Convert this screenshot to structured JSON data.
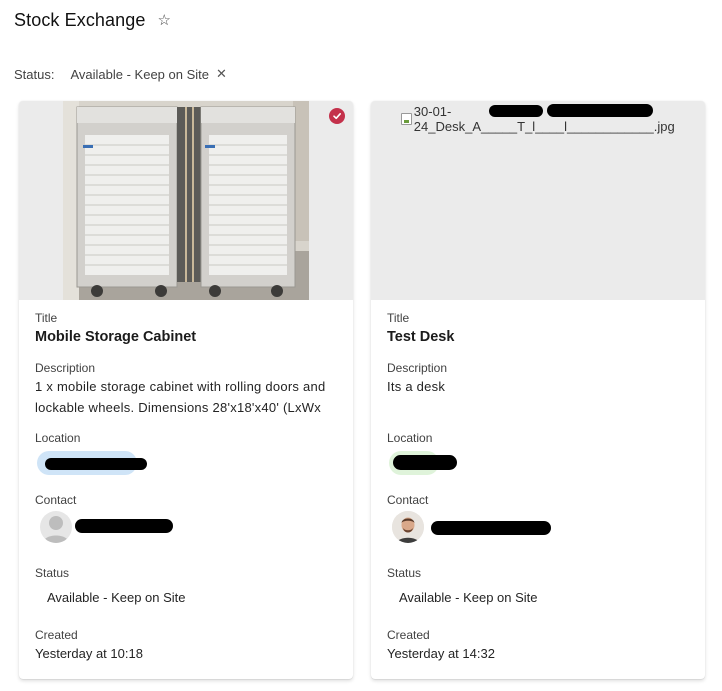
{
  "header": {
    "title": "Stock Exchange",
    "favorite_icon": "star-icon"
  },
  "filter": {
    "label": "Status:",
    "value": "Available - Keep on Site",
    "remove_icon": "close-icon"
  },
  "labels": {
    "title": "Title",
    "description": "Description",
    "location": "Location",
    "contact": "Contact",
    "status": "Status",
    "created": "Created"
  },
  "cards": [
    {
      "title": "Mobile Storage Cabinet",
      "description": "1 x mobile storage cabinet with rolling doors and lockable wheels. Dimensions 28'x18'x40' (LxWx",
      "status": "Available - Keep on Site",
      "created": "Yesterday at 10:18",
      "selected": true
    },
    {
      "image_alt": "30-01-24_Desk_A_____T_l____l____________.jpg",
      "title": "Test Desk",
      "description": "Its a desk",
      "status": "Available - Keep on Site",
      "created": "Yesterday at 14:32",
      "selected": false
    }
  ],
  "colors": {
    "accent": "#c4314b",
    "location_pill_1": "#cfe4f7",
    "location_pill_2": "#dff3da"
  }
}
